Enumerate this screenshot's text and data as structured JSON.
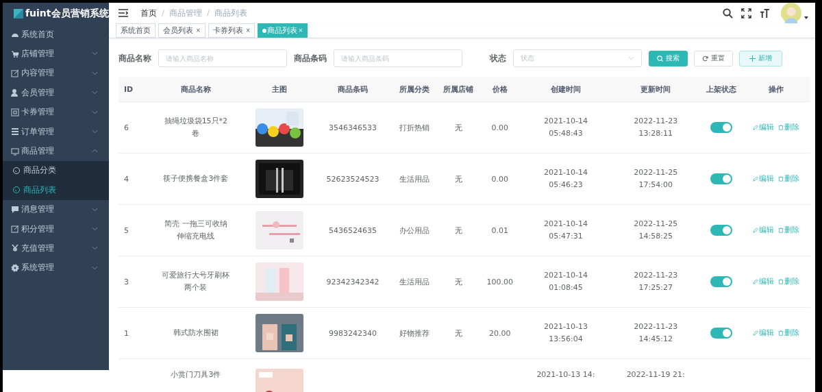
{
  "sidebar": {
    "logo": "fuint会员营销系统",
    "items": [
      {
        "label": "系统首页",
        "selected": false
      },
      {
        "label": "店铺管理",
        "expanded": false,
        "selected": false
      },
      {
        "label": "内容管理",
        "expanded": false,
        "selected": false
      },
      {
        "label": "会员管理",
        "expanded": false,
        "selected": false
      },
      {
        "label": "卡券管理",
        "expanded": false,
        "selected": false
      },
      {
        "label": "订单管理",
        "expanded": false,
        "selected": false
      },
      {
        "label": "商品管理",
        "expanded": true,
        "selected": false,
        "children": [
          {
            "label": "商品分类",
            "selected": false
          },
          {
            "label": "商品列表",
            "selected": true
          }
        ]
      },
      {
        "label": "消息管理",
        "expanded": false,
        "selected": false
      },
      {
        "label": "积分管理",
        "expanded": false,
        "selected": false
      },
      {
        "label": "充值管理",
        "expanded": false,
        "selected": false
      },
      {
        "label": "系统管理",
        "expanded": false,
        "selected": false
      }
    ]
  },
  "breadcrumb": [
    "首页",
    "商品管理",
    "商品列表"
  ],
  "tags": [
    {
      "label": "系统首页",
      "closable": false,
      "selected": false
    },
    {
      "label": "会员列表",
      "closable": true,
      "selected": false
    },
    {
      "label": "卡券列表",
      "closable": true,
      "selected": false
    },
    {
      "label": "商品列表",
      "closable": true,
      "selected": true
    }
  ],
  "close_mark": "×",
  "filters": [
    {
      "label": "商品名称",
      "placeholder": "请输入商品名称",
      "kind": "input"
    },
    {
      "label": "商品条码",
      "placeholder": "请输入商品条码",
      "kind": "input"
    },
    {
      "label": "状态",
      "placeholder": "状态",
      "kind": "select"
    }
  ],
  "buttons": [
    {
      "label": "搜索",
      "kind": "primary"
    },
    {
      "label": "重置",
      "kind": "default"
    },
    {
      "label": "新增",
      "kind": "add"
    }
  ],
  "table": {
    "columns": [
      "ID",
      "商品名称",
      "主图",
      "商品条码",
      "所属分类",
      "所属店铺",
      "价格",
      "创建时间",
      "更新时间",
      "上架状态",
      "操作"
    ],
    "rows": [
      {
        "id": "6",
        "name": "抽绳垃圾袋15只*2卷",
        "barcode": "3546346533",
        "category": "打折热销",
        "shop": "无",
        "price": "0.00",
        "created": "2021-10-14 05:48:43",
        "updated": "2022-11-23 13:28:11",
        "on": true,
        "actions": [
          "编辑",
          "删除"
        ]
      },
      {
        "id": "4",
        "name": "筷子便携餐盒3件套",
        "barcode": "52623524523",
        "category": "生活用品",
        "shop": "无",
        "price": "0.00",
        "created": "2021-10-14 05:46:23",
        "updated": "2022-11-25 17:54:00",
        "on": true,
        "actions": [
          "编辑",
          "删除"
        ]
      },
      {
        "id": "5",
        "name": "简壳 一拖三可收纳伸缩充电线",
        "barcode": "5436524635",
        "category": "办公用品",
        "shop": "无",
        "price": "0.01",
        "created": "2021-10-14 05:47:31",
        "updated": "2022-11-25 14:58:25",
        "on": true,
        "actions": [
          "编辑",
          "删除"
        ]
      },
      {
        "id": "3",
        "name": "可爱旅行大号牙刷杯两个装",
        "barcode": "92342342342",
        "category": "生活用品",
        "shop": "无",
        "price": "100.00",
        "created": "2021-10-14 01:08:45",
        "updated": "2022-11-23 17:25:27",
        "on": true,
        "actions": [
          "编辑",
          "删除"
        ]
      },
      {
        "id": "1",
        "name": "韩式防水围裙",
        "barcode": "9983242340",
        "category": "好物推荐",
        "shop": "无",
        "price": "20.00",
        "created": "2021-10-13 13:56:04",
        "updated": "2022-11-23 14:45:12",
        "on": true,
        "actions": [
          "编辑",
          "删除"
        ]
      },
      {
        "name": "小赏门刀具3件",
        "created": "2021-10-13 14:",
        "updated": "2022-11-19 21:"
      }
    ]
  }
}
